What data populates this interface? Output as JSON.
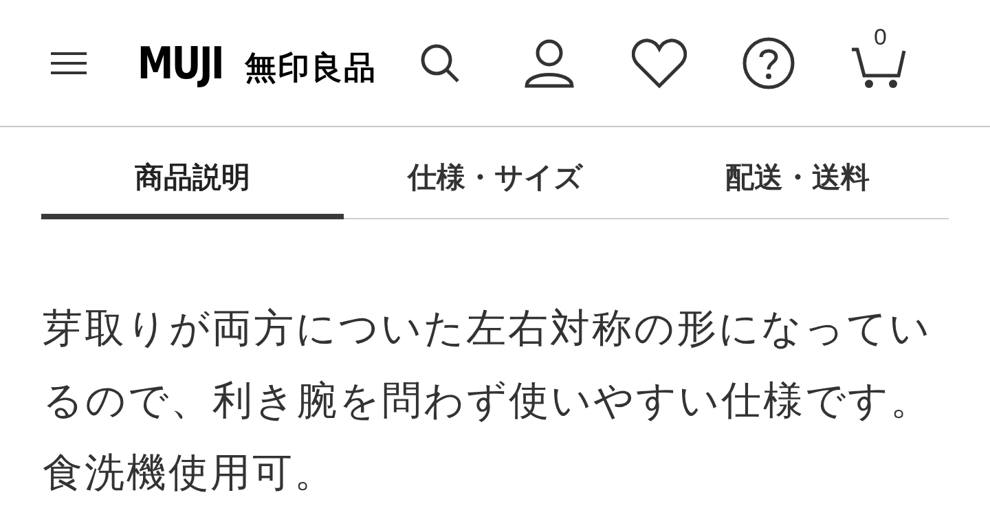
{
  "header": {
    "logo_text": "MUJI",
    "logo_kanji": "無印良品",
    "cart_count": "0"
  },
  "tabs": [
    {
      "label": "商品説明",
      "selected": true
    },
    {
      "label": "仕様・サイズ",
      "selected": false
    },
    {
      "label": "配送・送料",
      "selected": false
    }
  ],
  "description": "芽取りが両方についた左右対称の形になっているので、利き腕を問わず使いやすい仕様です。食洗機使用可。"
}
